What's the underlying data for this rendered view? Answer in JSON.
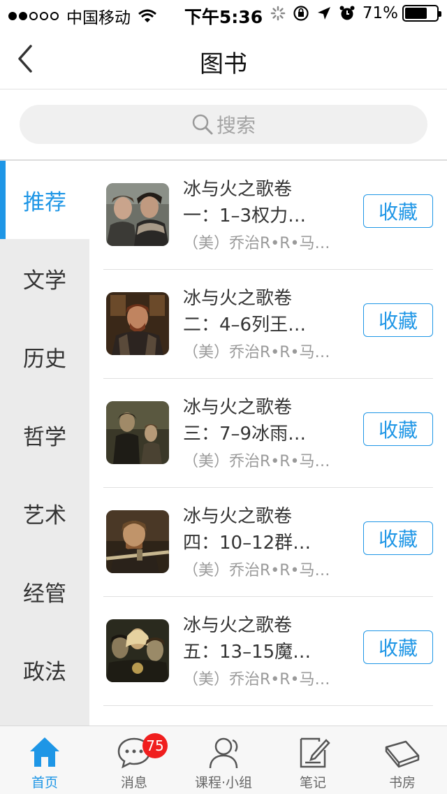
{
  "status_bar": {
    "carrier": "中国移动",
    "time": "下午5:36",
    "battery": "71%",
    "battery_level": 0.71
  },
  "nav": {
    "title": "图书",
    "back_icon": "chevron-left-icon"
  },
  "search": {
    "placeholder": "搜索",
    "icon": "search-icon"
  },
  "sidebar": {
    "items": [
      {
        "label": "推荐",
        "active": true
      },
      {
        "label": "文学",
        "active": false
      },
      {
        "label": "历史",
        "active": false
      },
      {
        "label": "哲学",
        "active": false
      },
      {
        "label": "艺术",
        "active": false
      },
      {
        "label": "经管",
        "active": false
      },
      {
        "label": "政法",
        "active": false
      }
    ]
  },
  "books": [
    {
      "title_line1": "冰与火之歌卷",
      "title_line2": "一：1–3权力…",
      "author": "（美）乔治R•R•马…",
      "fav_label": "收藏"
    },
    {
      "title_line1": "冰与火之歌卷",
      "title_line2": "二：4–6列王…",
      "author": "（美）乔治R•R•马…",
      "fav_label": "收藏"
    },
    {
      "title_line1": "冰与火之歌卷",
      "title_line2": "三：7–9冰雨…",
      "author": "（美）乔治R•R•马…",
      "fav_label": "收藏"
    },
    {
      "title_line1": "冰与火之歌卷",
      "title_line2": "四：10–12群…",
      "author": "（美）乔治R•R•马…",
      "fav_label": "收藏"
    },
    {
      "title_line1": "冰与火之歌卷",
      "title_line2": "五：13–15魔…",
      "author": "（美）乔治R•R•马…",
      "fav_label": "收藏"
    }
  ],
  "tab_bar": {
    "items": [
      {
        "label": "首页",
        "icon": "home-icon",
        "active": true
      },
      {
        "label": "消息",
        "icon": "chat-bubble-icon",
        "badge": "75"
      },
      {
        "label": "课程·小组",
        "icon": "people-icon"
      },
      {
        "label": "笔记",
        "icon": "note-icon"
      },
      {
        "label": "书房",
        "icon": "bookshelf-icon"
      }
    ]
  },
  "colors": {
    "accent": "#1e96e6",
    "badge": "#f01e1e",
    "sidebar_bg": "#ebebeb",
    "tab_bar_bg": "#f7f7f7"
  }
}
